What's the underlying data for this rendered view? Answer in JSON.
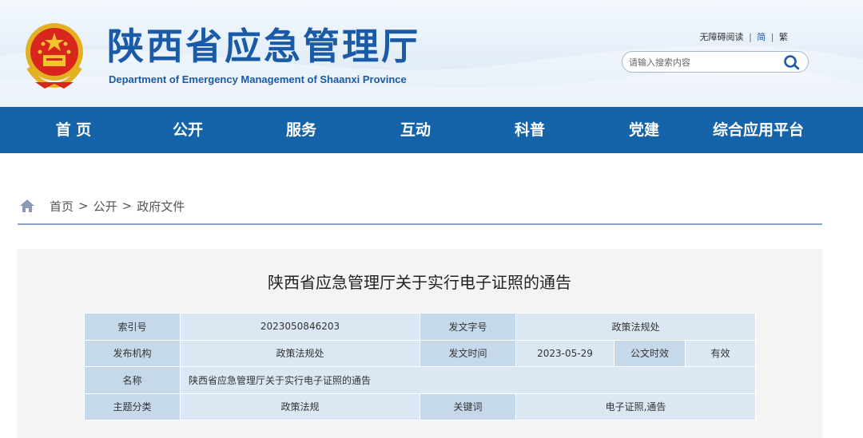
{
  "header": {
    "title": "陕西省应急管理厅",
    "subtitle": "Department of Emergency Management of Shaanxi Province",
    "accessibility_link": "无障碍阅读",
    "lang_simplified": "简",
    "lang_traditional": "繁",
    "separator": "|",
    "search_placeholder": "请输入搜索内容",
    "emblem_icon": "national-emblem-icon",
    "search_icon": "search-icon"
  },
  "nav": {
    "items": [
      {
        "label": "首 页"
      },
      {
        "label": "公开"
      },
      {
        "label": "服务"
      },
      {
        "label": "互动"
      },
      {
        "label": "科普"
      },
      {
        "label": "党建"
      },
      {
        "label": "综合应用平台"
      }
    ]
  },
  "breadcrumb": {
    "icon": "home-icon",
    "items": [
      "首页",
      "公开",
      "政府文件"
    ],
    "separator": ">"
  },
  "article": {
    "title": "陕西省应急管理厅关于实行电子证照的通告",
    "meta": {
      "index_label": "索引号",
      "index_value": "2023050846203",
      "doc_no_label": "发文字号",
      "doc_no_value": "政策法规处",
      "issuer_label": "发布机构",
      "issuer_value": "政策法规处",
      "date_label": "发文时间",
      "date_value": "2023-05-29",
      "validity_label": "公文时效",
      "validity_value": "有效",
      "name_label": "名称",
      "name_value": "陕西省应急管理厅关于实行电子证照的通告",
      "topic_label": "主题分类",
      "topic_value": "政策法规",
      "keywords_label": "关键词",
      "keywords_value": "电子证照,通告"
    }
  },
  "colors": {
    "brand_blue": "#1a5aa6",
    "nav_bg": "#1563a8",
    "table_key_bg": "#c6d9ea",
    "table_value_bg": "#dbe7f2"
  }
}
